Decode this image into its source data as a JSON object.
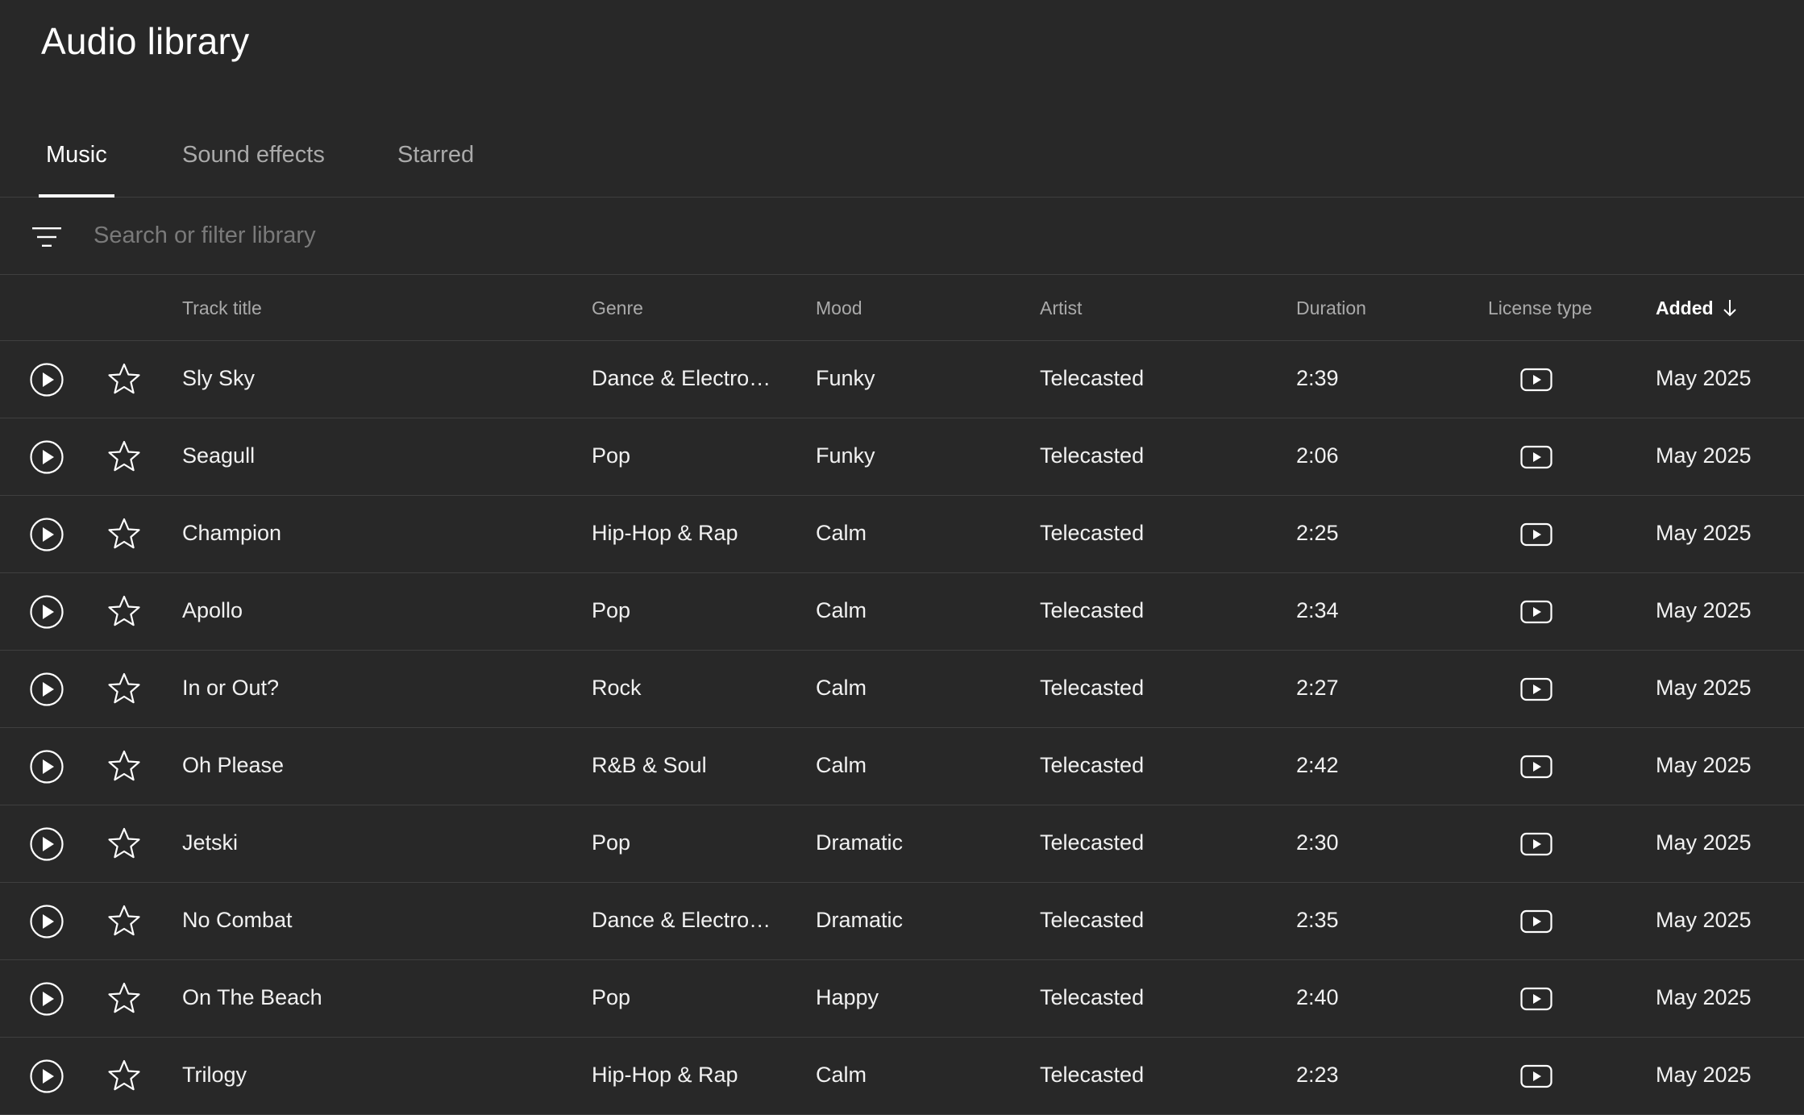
{
  "header": {
    "title": "Audio library"
  },
  "tabs": [
    {
      "label": "Music",
      "active": true
    },
    {
      "label": "Sound effects",
      "active": false
    },
    {
      "label": "Starred",
      "active": false
    }
  ],
  "search": {
    "placeholder": "Search or filter library",
    "value": ""
  },
  "table": {
    "columns": {
      "title": "Track title",
      "genre": "Genre",
      "mood": "Mood",
      "artist": "Artist",
      "duration": "Duration",
      "license": "License type",
      "added": "Added"
    },
    "sort": {
      "column": "Added",
      "direction": "descending"
    },
    "rows": [
      {
        "title": "Sly Sky",
        "genre": "Dance & Electro…",
        "mood": "Funky",
        "artist": "Telecasted",
        "duration": "2:39",
        "license_icon": "youtube-icon",
        "added": "May 2025"
      },
      {
        "title": "Seagull",
        "genre": "Pop",
        "mood": "Funky",
        "artist": "Telecasted",
        "duration": "2:06",
        "license_icon": "youtube-icon",
        "added": "May 2025"
      },
      {
        "title": "Champion",
        "genre": "Hip-Hop & Rap",
        "mood": "Calm",
        "artist": "Telecasted",
        "duration": "2:25",
        "license_icon": "youtube-icon",
        "added": "May 2025"
      },
      {
        "title": "Apollo",
        "genre": "Pop",
        "mood": "Calm",
        "artist": "Telecasted",
        "duration": "2:34",
        "license_icon": "youtube-icon",
        "added": "May 2025"
      },
      {
        "title": "In or Out?",
        "genre": "Rock",
        "mood": "Calm",
        "artist": "Telecasted",
        "duration": "2:27",
        "license_icon": "youtube-icon",
        "added": "May 2025"
      },
      {
        "title": "Oh Please",
        "genre": "R&B & Soul",
        "mood": "Calm",
        "artist": "Telecasted",
        "duration": "2:42",
        "license_icon": "youtube-icon",
        "added": "May 2025"
      },
      {
        "title": "Jetski",
        "genre": "Pop",
        "mood": "Dramatic",
        "artist": "Telecasted",
        "duration": "2:30",
        "license_icon": "youtube-icon",
        "added": "May 2025"
      },
      {
        "title": "No Combat",
        "genre": "Dance & Electro…",
        "mood": "Dramatic",
        "artist": "Telecasted",
        "duration": "2:35",
        "license_icon": "youtube-icon",
        "added": "May 2025"
      },
      {
        "title": "On The Beach",
        "genre": "Pop",
        "mood": "Happy",
        "artist": "Telecasted",
        "duration": "2:40",
        "license_icon": "youtube-icon",
        "added": "May 2025"
      },
      {
        "title": "Trilogy",
        "genre": "Hip-Hop & Rap",
        "mood": "Calm",
        "artist": "Telecasted",
        "duration": "2:23",
        "license_icon": "youtube-icon",
        "added": "May 2025"
      }
    ]
  },
  "colors": {
    "background": "#282828",
    "text_primary": "#ffffff",
    "text_secondary": "#aaaaaa",
    "divider": "#3f3f3f"
  }
}
